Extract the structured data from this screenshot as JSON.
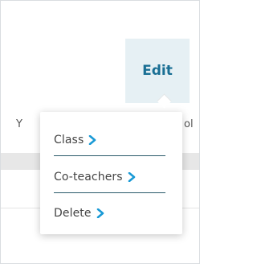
{
  "edit_button": {
    "label": "Edit"
  },
  "background_text": {
    "left": "Y",
    "right": "ol"
  },
  "dropdown": {
    "items": [
      {
        "label": "Class"
      },
      {
        "label": "Co-teachers"
      },
      {
        "label": "Delete"
      }
    ]
  },
  "colors": {
    "accent": "#1a6f94",
    "edit_background": "#e6f0f4",
    "chevron": "#1a9ad6",
    "item_separator": "#2a5a6a"
  },
  "icons": {
    "chevron": "chevron-right-icon"
  }
}
